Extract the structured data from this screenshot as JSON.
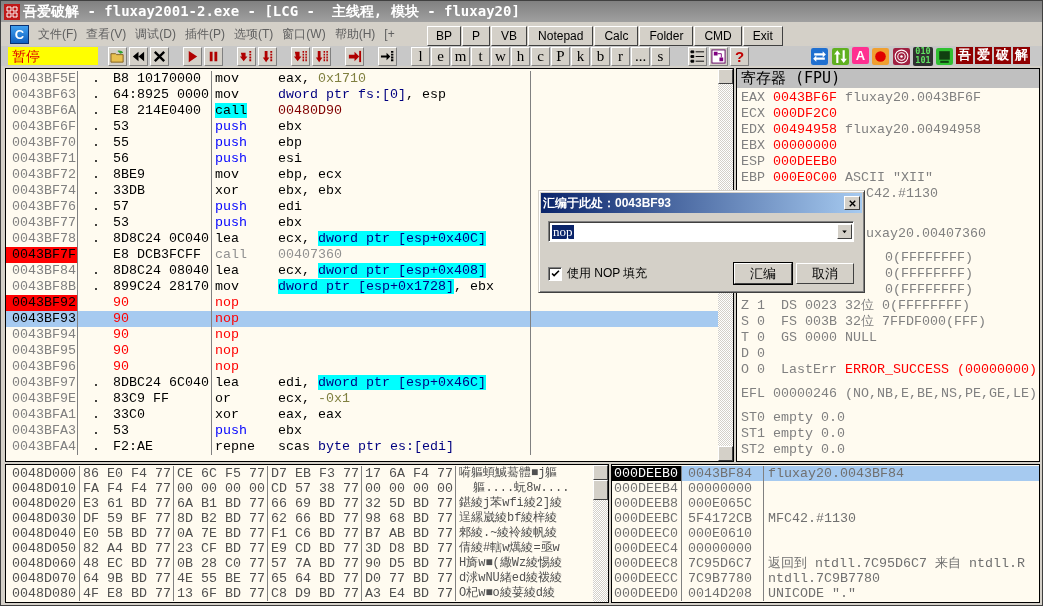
{
  "window": {
    "title": "吾爱破解 - fluxay2001-2.exe - [LCG -  主线程, 模块 - fluxay20]"
  },
  "menu": {
    "icon_letter": "C",
    "items": [
      "文件(F)",
      "查看(V)",
      "调试(D)",
      "插件(P)",
      "选项(T)",
      "窗口(W)",
      "帮助(H)",
      "[+"
    ]
  },
  "quick_buttons": [
    "BP",
    "P",
    "VB",
    "Notepad",
    "Calc",
    "Folder",
    "CMD",
    "Exit"
  ],
  "toolbar": {
    "status": "暂停",
    "debug_buttons": [
      {
        "kind": "open"
      },
      {
        "kind": "rewind"
      },
      {
        "kind": "close"
      },
      {
        "kind": "run"
      },
      {
        "kind": "pause"
      },
      {
        "kind": "step_into"
      },
      {
        "kind": "step_over"
      },
      {
        "kind": "trace_into"
      },
      {
        "kind": "trace_over"
      },
      {
        "kind": "till_return"
      },
      {
        "kind": "goto"
      }
    ],
    "window_buttons": [
      "l",
      "e",
      "m",
      "t",
      "w",
      "h",
      "c",
      "P",
      "k",
      "b",
      "r",
      "...",
      "s"
    ],
    "extra_buttons": [
      {
        "kind": "list"
      },
      {
        "kind": "tree"
      },
      {
        "kind": "help",
        "label": "?"
      }
    ],
    "plugin_buttons": [
      {
        "kind": "swap"
      },
      {
        "kind": "updown"
      },
      {
        "kind": "badge",
        "label": "A"
      },
      {
        "kind": "record"
      },
      {
        "kind": "target"
      },
      {
        "kind": "binary",
        "lines": [
          "010",
          "101"
        ]
      },
      {
        "kind": "screen"
      },
      {
        "kind": "brand",
        "label": "吾"
      },
      {
        "kind": "brand",
        "label": "爱"
      },
      {
        "kind": "brand",
        "label": "破"
      },
      {
        "kind": "brand",
        "label": "解"
      }
    ]
  },
  "disasm": {
    "rows": [
      {
        "address": "0043BF5E",
        "breakpoint": false,
        "selected": false,
        "marker": ".",
        "hex": "B8 10170000",
        "patched": false,
        "mnemonic": "mov",
        "kind": "plain",
        "operands": [
          {
            "text": "eax, ",
            "kind": "text"
          },
          {
            "text": "0x1710",
            "kind": "imm"
          }
        ]
      },
      {
        "address": "0043BF63",
        "breakpoint": false,
        "selected": false,
        "marker": ".",
        "hex": "64:8925 0000",
        "patched": false,
        "mnemonic": "mov",
        "kind": "plain",
        "operands": [
          {
            "text": "dword ptr fs:[0]",
            "kind": "mem"
          },
          {
            "text": ", esp",
            "kind": "text"
          }
        ]
      },
      {
        "address": "0043BF6A",
        "breakpoint": false,
        "selected": false,
        "marker": ".",
        "hex": "E8 214E0400",
        "patched": false,
        "mnemonic": "call",
        "kind": "call",
        "operands": [
          {
            "text": "00480D90",
            "kind": "addr"
          }
        ]
      },
      {
        "address": "0043BF6F",
        "breakpoint": false,
        "selected": false,
        "marker": ".",
        "hex": "53",
        "patched": false,
        "mnemonic": "push",
        "kind": "push",
        "operands": [
          {
            "text": "ebx",
            "kind": "text"
          }
        ]
      },
      {
        "address": "0043BF70",
        "breakpoint": false,
        "selected": false,
        "marker": ".",
        "hex": "55",
        "patched": false,
        "mnemonic": "push",
        "kind": "push",
        "operands": [
          {
            "text": "ebp",
            "kind": "text"
          }
        ]
      },
      {
        "address": "0043BF71",
        "breakpoint": false,
        "selected": false,
        "marker": ".",
        "hex": "56",
        "patched": false,
        "mnemonic": "push",
        "kind": "push",
        "operands": [
          {
            "text": "esi",
            "kind": "text"
          }
        ]
      },
      {
        "address": "0043BF72",
        "breakpoint": false,
        "selected": false,
        "marker": ".",
        "hex": "8BE9",
        "patched": false,
        "mnemonic": "mov",
        "kind": "plain",
        "operands": [
          {
            "text": "ebp, ecx",
            "kind": "text"
          }
        ]
      },
      {
        "address": "0043BF74",
        "breakpoint": false,
        "selected": false,
        "marker": ".",
        "hex": "33DB",
        "patched": false,
        "mnemonic": "xor",
        "kind": "plain",
        "operands": [
          {
            "text": "ebx, ebx",
            "kind": "text"
          }
        ]
      },
      {
        "address": "0043BF76",
        "breakpoint": false,
        "selected": false,
        "marker": ".",
        "hex": "57",
        "patched": false,
        "mnemonic": "push",
        "kind": "push",
        "operands": [
          {
            "text": "edi",
            "kind": "text"
          }
        ]
      },
      {
        "address": "0043BF77",
        "breakpoint": false,
        "selected": false,
        "marker": ".",
        "hex": "53",
        "patched": false,
        "mnemonic": "push",
        "kind": "push",
        "operands": [
          {
            "text": "ebx",
            "kind": "text"
          }
        ]
      },
      {
        "address": "0043BF78",
        "breakpoint": false,
        "selected": false,
        "marker": ".",
        "hex": "8D8C24 0C040",
        "patched": false,
        "mnemonic": "lea",
        "kind": "plain",
        "operands": [
          {
            "text": "ecx, ",
            "kind": "text"
          },
          {
            "text": "dword ptr [esp+0x40C]",
            "kind": "memhl"
          }
        ]
      },
      {
        "address": "0043BF7F",
        "breakpoint": true,
        "selected": false,
        "hex": "E8 DCB3FCFF",
        "patched": false,
        "mnemonic": "call",
        "kind": "gray",
        "operands": [
          {
            "text": "00407360",
            "kind": "gray"
          }
        ]
      },
      {
        "address": "0043BF84",
        "breakpoint": false,
        "selected": false,
        "marker": ".",
        "hex": "8D8C24 08040",
        "patched": false,
        "mnemonic": "lea",
        "kind": "plain",
        "operands": [
          {
            "text": "ecx, ",
            "kind": "text"
          },
          {
            "text": "dword ptr [esp+0x408]",
            "kind": "memhl"
          }
        ]
      },
      {
        "address": "0043BF8B",
        "breakpoint": false,
        "selected": false,
        "marker": ".",
        "hex": "899C24 28170",
        "patched": false,
        "mnemonic": "mov",
        "kind": "plain",
        "operands": [
          {
            "text": "dword ptr [esp+0x1728]",
            "kind": "memhl"
          },
          {
            "text": ", ebx",
            "kind": "text"
          }
        ]
      },
      {
        "address": "0043BF92",
        "breakpoint": true,
        "selected": false,
        "hex": "90",
        "patched": true,
        "mnemonic": "nop",
        "kind": "nop",
        "operands": []
      },
      {
        "address": "0043BF93",
        "breakpoint": false,
        "selected": true,
        "hex": "90",
        "patched": true,
        "mnemonic": "nop",
        "kind": "nop",
        "operands": []
      },
      {
        "address": "0043BF94",
        "breakpoint": false,
        "selected": false,
        "hex": "90",
        "patched": true,
        "mnemonic": "nop",
        "kind": "nop",
        "operands": []
      },
      {
        "address": "0043BF95",
        "breakpoint": false,
        "selected": false,
        "hex": "90",
        "patched": true,
        "mnemonic": "nop",
        "kind": "nop",
        "operands": []
      },
      {
        "address": "0043BF96",
        "breakpoint": false,
        "selected": false,
        "hex": "90",
        "patched": true,
        "mnemonic": "nop",
        "kind": "nop",
        "operands": []
      },
      {
        "address": "0043BF97",
        "breakpoint": false,
        "selected": false,
        "marker": ".",
        "hex": "8DBC24 6C040",
        "patched": false,
        "mnemonic": "lea",
        "kind": "plain",
        "operands": [
          {
            "text": "edi, ",
            "kind": "text"
          },
          {
            "text": "dword ptr [esp+0x46C]",
            "kind": "memhl"
          }
        ]
      },
      {
        "address": "0043BF9E",
        "breakpoint": false,
        "selected": false,
        "marker": ".",
        "hex": "83C9 FF",
        "patched": false,
        "mnemonic": "or",
        "kind": "plain",
        "operands": [
          {
            "text": "ecx, ",
            "kind": "text"
          },
          {
            "text": "-0x1",
            "kind": "imm"
          }
        ]
      },
      {
        "address": "0043BFA1",
        "breakpoint": false,
        "selected": false,
        "marker": ".",
        "hex": "33C0",
        "patched": false,
        "mnemonic": "xor",
        "kind": "plain",
        "operands": [
          {
            "text": "eax, eax",
            "kind": "text"
          }
        ]
      },
      {
        "address": "0043BFA3",
        "breakpoint": false,
        "selected": false,
        "marker": ".",
        "hex": "53",
        "patched": false,
        "mnemonic": "push",
        "kind": "push",
        "operands": [
          {
            "text": "ebx",
            "kind": "text"
          }
        ]
      },
      {
        "address": "0043BFA4",
        "breakpoint": false,
        "selected": false,
        "marker": ".",
        "hex": "F2:AE",
        "patched": false,
        "mnemonic": "repne",
        "kind": "plain",
        "operands": [
          {
            "text": "scas ",
            "kind": "text"
          },
          {
            "text": "byte ptr es:[edi]",
            "kind": "mem"
          }
        ]
      }
    ]
  },
  "registers": {
    "title": "寄存器 (FPU)",
    "groups": [
      [
        {
          "kind": "reg",
          "name": "EAX",
          "value": "0043BF6F",
          "changed": true,
          "comment": "fluxay20.0043BF6F"
        },
        {
          "kind": "reg",
          "name": "ECX",
          "value": "000DF2C0",
          "changed": true
        },
        {
          "kind": "reg",
          "name": "EDX",
          "value": "00494958",
          "changed": true,
          "comment": "fluxay20.00494958"
        },
        {
          "kind": "reg",
          "name": "EBX",
          "value": "00000000",
          "changed": true
        },
        {
          "kind": "reg",
          "name": "ESP",
          "value": "000DEEB0",
          "changed": true
        },
        {
          "kind": "reg",
          "name": "EBP",
          "value": "000E0C00",
          "changed": true,
          "comment": "ASCII \"XII\""
        },
        {
          "kind": "tail",
          "text": "C42.#1130"
        }
      ],
      [
        {
          "kind": "tail",
          "text": "uxay20.00407360"
        }
      ],
      [
        {
          "kind": "flag_tail",
          "text": "0(FFFFFFFF)"
        },
        {
          "kind": "flag_tail",
          "text": "0(FFFFFFFF)"
        },
        {
          "kind": "flag_tail",
          "text": "0(FFFFFFFF)"
        },
        {
          "kind": "line",
          "text": "Z 1  DS 0023 32位 0(FFFFFFFF)"
        },
        {
          "kind": "line",
          "text": "S 0  FS 003B 32位 7FFDF000(FFF)"
        },
        {
          "kind": "line",
          "text": "T 0  GS 0000 NULL"
        },
        {
          "kind": "line",
          "text": "D 0"
        },
        {
          "kind": "line",
          "text": "O 0  LastErr ",
          "alert": "ERROR_SUCCESS (00000000)"
        }
      ],
      [
        {
          "kind": "line",
          "text": "EFL 00000246 (NO,NB,E,BE,NS,PE,GE,LE)"
        }
      ],
      [
        {
          "kind": "line",
          "text": "ST0 empty 0.0"
        },
        {
          "kind": "line",
          "text": "ST1 empty 0.0"
        },
        {
          "kind": "line",
          "text": "ST2 empty 0.0"
        }
      ]
    ]
  },
  "dialog": {
    "title": "汇编于此处：0043BF93",
    "value": "nop",
    "value_selected": true,
    "nop_fill": {
      "label": "使用 NOP 填充",
      "checked": true
    },
    "buttons": [
      "汇编",
      "取消"
    ]
  },
  "dump": {
    "rows": [
      {
        "address": "0048D000",
        "groups": [
          "86 E0 F4 77",
          "CE 6C F5 77",
          "D7 EB F3 77",
          "17 6A F4 77"
        ],
        "text": "嗬軀蝢鰔驀體■j軀"
      },
      {
        "address": "0048D010",
        "groups": [
          "FA F4 F4 77",
          "00 00 00 00",
          "CD 57 38 77",
          "00 00 00 00"
        ],
        "text": "  軀....蚖8w...."
      },
      {
        "address": "0048D020",
        "groups": [
          "E3 61 BD 77",
          "6A B1 BD 77",
          "66 69 BD 77",
          "32 5D BD 77"
        ],
        "text": "鍖綾j苯wfi綾2]綾"
      },
      {
        "address": "0048D030",
        "groups": [
          "DF 59 BF 77",
          "8D B2 BD 77",
          "62 66 BD 77",
          "98 68 BD 77"
        ],
        "text": "逞縲崴綾bf綾梓綾"
      },
      {
        "address": "0048D040",
        "groups": [
          "E0 5B BD 77",
          "0A 7E BD 77",
          "F1 C6 BD 77",
          "B7 AB BD 77"
        ],
        "text": "郲綾.~綾袊綾帆綾"
      },
      {
        "address": "0048D050",
        "groups": [
          "82 A4 BD 77",
          "23 CF BD 77",
          "E9 CD BD 77",
          "3D D8 BD 77"
        ],
        "text": "倩綾#轄w燤綾=亟w"
      },
      {
        "address": "0048D060",
        "groups": [
          "48 EC BD 77",
          "0B 28 C0 77",
          "57 7A BD 77",
          "90 D5 BD 77"
        ],
        "text": "H旖w■(繖Wz綾惕綾"
      },
      {
        "address": "0048D070",
        "groups": [
          "64 9B BD 77",
          "4E 55 BE 77",
          "65 64 BD 77",
          "D0 77 BD 77"
        ],
        "text": "d浗wNU緒ed綾袯綾"
      },
      {
        "address": "0048D080",
        "groups": [
          "4F E8 BD 77",
          "13 6F BD 77",
          "C8 D9 BD 77",
          "A3 E4 BD 77"
        ],
        "text": "O杞w■o綾荽綾d綾"
      }
    ]
  },
  "stack": {
    "rows": [
      {
        "address": "000DEEB0",
        "value": "0043BF84",
        "comment": "fluxay20.0043BF84",
        "selected": true
      },
      {
        "address": "000DEEB4",
        "value": "00000000",
        "selected": false
      },
      {
        "address": "000DEEB8",
        "value": "000E065C",
        "selected": false
      },
      {
        "address": "000DEEBC",
        "value": "5F4172CB",
        "comment": "MFC42.#1130",
        "selected": false
      },
      {
        "address": "000DEEC0",
        "value": "000E0610",
        "selected": false
      },
      {
        "address": "000DEEC4",
        "value": "00000000",
        "selected": false
      },
      {
        "address": "000DEEC8",
        "value": "7C95D6C7",
        "comment": "返回到 ntdll.7C95D6C7 来自 ntdll.R",
        "selected": false
      },
      {
        "address": "000DEECC",
        "value": "7C9B7780",
        "comment": "ntdll.7C9B7780",
        "selected": false
      },
      {
        "address": "000DEED0",
        "value": "0014D208",
        "comment": "UNICODE \".\"",
        "selected": false
      }
    ]
  }
}
